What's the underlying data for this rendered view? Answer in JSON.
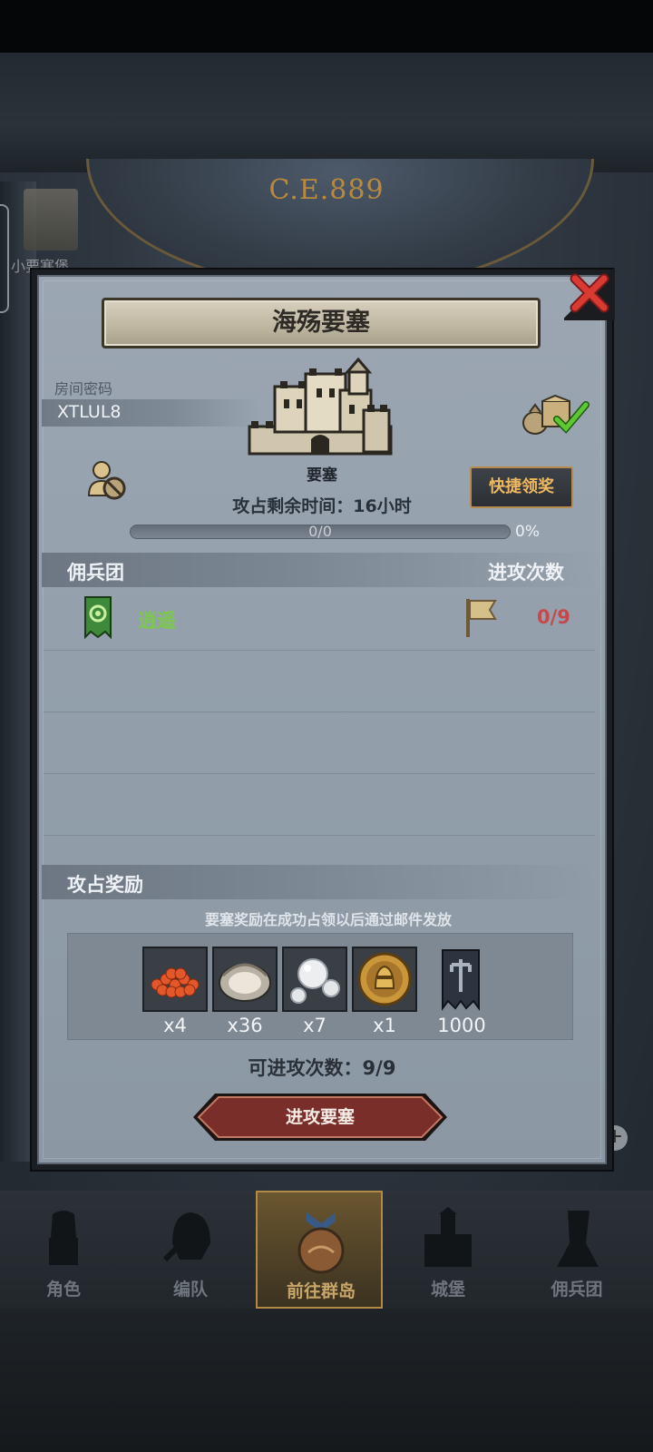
{
  "background": {
    "era_label": "C.E.889",
    "left_partial_text": "小要塞堡"
  },
  "panel": {
    "title": "海殇要塞",
    "room_code_label": "房间密码",
    "room_code": "XTLUL8",
    "fortress_name": "要塞",
    "remaining_time": "攻占剩余时间：16小时",
    "quick_claim": "快捷领奖",
    "progress_text": "0/0",
    "progress_percent": "0%",
    "progress_fraction": 0
  },
  "mercenary": {
    "section_label": "佣兵团",
    "count_header": "进攻次数",
    "rows": [
      {
        "name": "逍遥",
        "attacks": "0/9"
      }
    ]
  },
  "rewards": {
    "section_label": "攻占奖励",
    "note": "要塞奖励在成功占领以后通过邮件发放",
    "items": [
      {
        "icon": "roe-icon",
        "qty": "x4"
      },
      {
        "icon": "oyster-icon",
        "qty": "x36"
      },
      {
        "icon": "pearl-icon",
        "qty": "x7"
      },
      {
        "icon": "knight-coin-icon",
        "qty": "x1"
      },
      {
        "icon": "banner-emblem-icon",
        "qty": "1000"
      }
    ]
  },
  "attempts": "可进攻次数：9/9",
  "attack_button": "进攻要塞",
  "nav": [
    {
      "label": "角色",
      "icon": "knight-icon"
    },
    {
      "label": "编队",
      "icon": "helmet-icon"
    },
    {
      "label": "前往群岛",
      "icon": "island-icon"
    },
    {
      "label": "城堡",
      "icon": "castle-icon"
    },
    {
      "label": "佣兵团",
      "icon": "mercenary-icon"
    }
  ],
  "colors": {
    "accent_gold": "#f0b860",
    "guild_green": "#7cc84c",
    "count_red": "#c7484a",
    "attack_button": "#7a2e2a"
  }
}
